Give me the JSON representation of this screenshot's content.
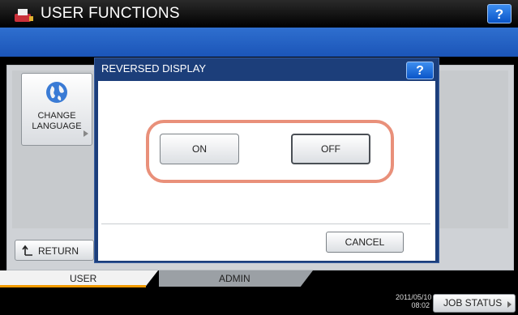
{
  "header": {
    "title": "USER FUNCTIONS",
    "help_label": "?"
  },
  "sidebar": {
    "change_language": {
      "line1": "CHANGE",
      "line2": "LANGUAGE"
    },
    "return_label": "RETURN"
  },
  "dialog": {
    "title": "REVERSED DISPLAY",
    "help_label": "?",
    "options": [
      {
        "label": "ON",
        "selected": false
      },
      {
        "label": "OFF",
        "selected": true
      }
    ],
    "cancel_label": "CANCEL"
  },
  "tabs": [
    {
      "label": "USER",
      "active": true
    },
    {
      "label": "ADMIN",
      "active": false
    }
  ],
  "status": {
    "date": "2011/05/10",
    "time": "08:02",
    "job_status_label": "JOB STATUS"
  },
  "icons": {
    "app": "printer-icon",
    "globe": "globe-icon",
    "return": "return-arrow-icon"
  },
  "colors": {
    "accent_blue": "#1b55b8",
    "highlight_ring": "#e9907a",
    "tab_accent": "#f39a00"
  }
}
